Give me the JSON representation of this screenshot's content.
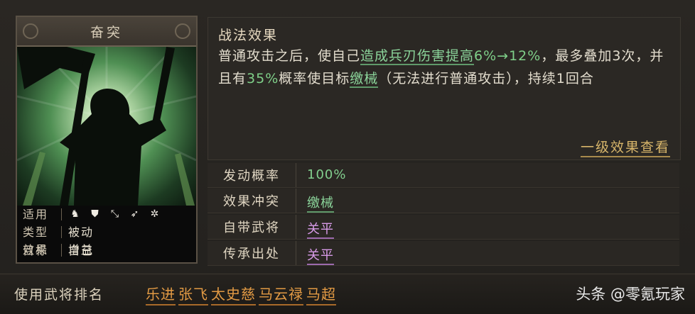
{
  "card": {
    "title": "奋突",
    "stats": [
      {
        "key": "适用",
        "value": ""
      },
      {
        "key": "类型",
        "value": "被动"
      },
      {
        "key": "效果",
        "value": "增益"
      },
      {
        "key": "目标",
        "value": "自己"
      }
    ],
    "weapon_icons": [
      "cavalry-icon",
      "shield-icon",
      "bow-icon",
      "spear-icon",
      "wheel-icon"
    ]
  },
  "description": {
    "title": "战法效果",
    "segments": [
      {
        "text": "普通攻击之后，使自己",
        "style": "normal"
      },
      {
        "text": "造成兵刃伤害提高",
        "style": "under"
      },
      {
        "text": "6%→12%",
        "style": "green"
      },
      {
        "text": "，最多叠加3次，并且有",
        "style": "normal"
      },
      {
        "text": "35%",
        "style": "green"
      },
      {
        "text": "概率使目标",
        "style": "normal"
      },
      {
        "text": "缴械",
        "style": "under"
      },
      {
        "text": "（无法进行普通攻击），持续1回合",
        "style": "normal"
      }
    ],
    "more_link": "一级效果查看"
  },
  "info_rows": [
    {
      "key": "发动概率",
      "value": "100%",
      "style": "green"
    },
    {
      "key": "效果冲突",
      "value": "缴械",
      "style": "under"
    },
    {
      "key": "自带武将",
      "value": "关平",
      "style": "purple"
    },
    {
      "key": "传承出处",
      "value": "关平",
      "style": "purple"
    }
  ],
  "bottom": {
    "label": "使用武将排名",
    "generals": [
      "乐进",
      "张飞",
      "太史慈",
      "马云禄",
      "马超"
    ],
    "watermark": "头条 @零氪玩家"
  }
}
